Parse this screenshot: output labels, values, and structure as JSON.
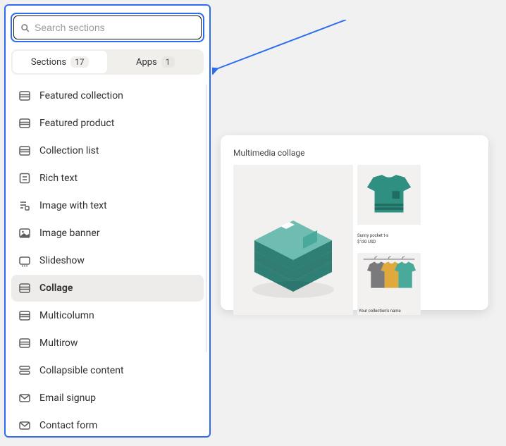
{
  "search": {
    "placeholder": "Search sections",
    "value": ""
  },
  "tabs": {
    "sections": {
      "label": "Sections",
      "count": "17",
      "active": true
    },
    "apps": {
      "label": "Apps",
      "count": "1",
      "active": false
    }
  },
  "sections": [
    {
      "label": "Featured collection",
      "icon": "section",
      "selected": false
    },
    {
      "label": "Featured product",
      "icon": "section",
      "selected": false
    },
    {
      "label": "Collection list",
      "icon": "section",
      "selected": false
    },
    {
      "label": "Rich text",
      "icon": "richtext",
      "selected": false
    },
    {
      "label": "Image with text",
      "icon": "imagetext",
      "selected": false
    },
    {
      "label": "Image banner",
      "icon": "imagebanner",
      "selected": false
    },
    {
      "label": "Slideshow",
      "icon": "slideshow",
      "selected": false
    },
    {
      "label": "Collage",
      "icon": "section",
      "selected": true
    },
    {
      "label": "Multicolumn",
      "icon": "section",
      "selected": false
    },
    {
      "label": "Multirow",
      "icon": "section",
      "selected": false
    },
    {
      "label": "Collapsible content",
      "icon": "collapsible",
      "selected": false
    },
    {
      "label": "Email signup",
      "icon": "email",
      "selected": false
    },
    {
      "label": "Contact form",
      "icon": "email",
      "selected": false
    }
  ],
  "preview": {
    "title": "Multimedia collage",
    "product_name": "Sunny pocket t-s",
    "product_price": "$130 USD",
    "collection_caption": "Your collection's name"
  },
  "colors": {
    "highlight": "#2b6cf0",
    "teal_dark": "#2f7f74",
    "teal": "#49a99a",
    "teal_light": "#6fbdb1"
  }
}
